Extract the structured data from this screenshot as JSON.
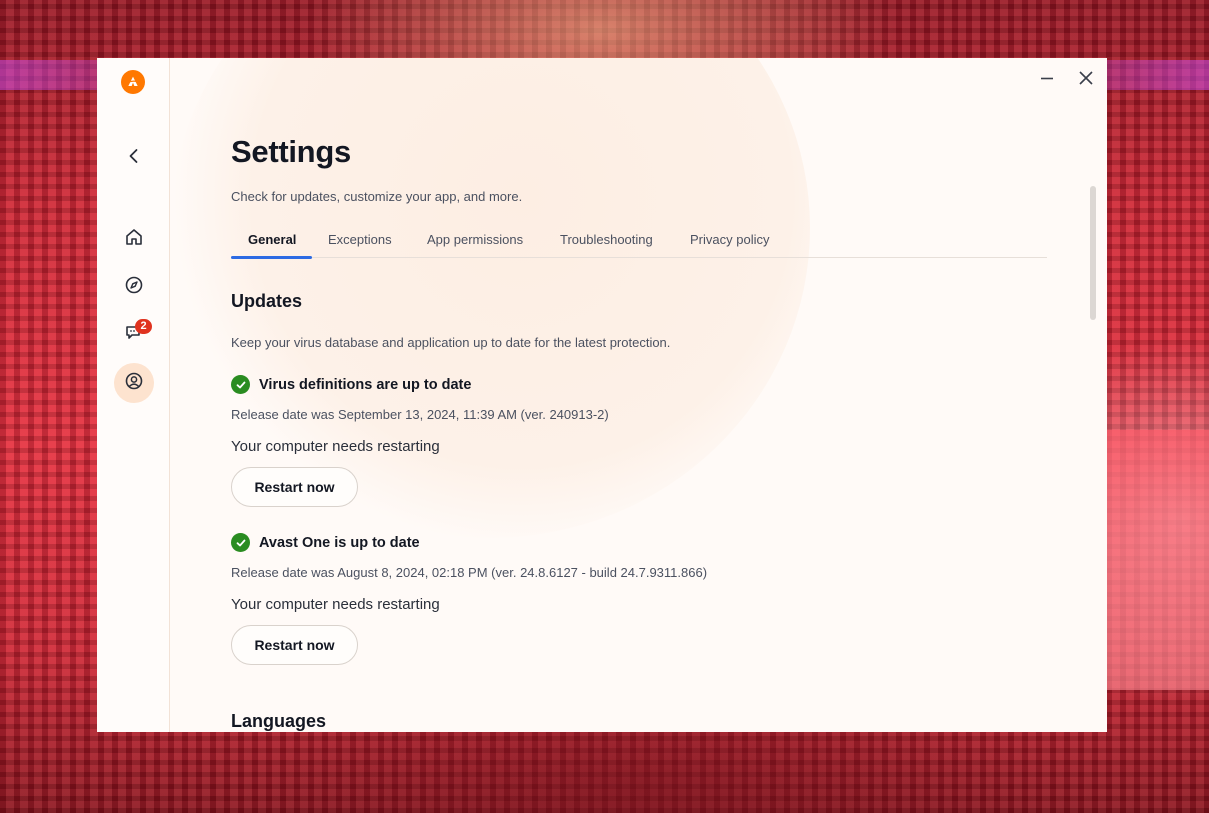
{
  "sidebar": {
    "logo_icon": "avast-logo-icon",
    "back_icon": "chevron-left-icon",
    "items": [
      {
        "icon": "home-icon"
      },
      {
        "icon": "compass-icon"
      },
      {
        "icon": "messages-icon",
        "badge": "2"
      },
      {
        "icon": "account-icon",
        "active": true
      }
    ]
  },
  "window": {
    "minimize_icon": "minimize-icon",
    "close_icon": "close-icon"
  },
  "header": {
    "title": "Settings",
    "subtitle": "Check for updates, customize your app, and more."
  },
  "tabs": [
    {
      "label": "General",
      "active": true
    },
    {
      "label": "Exceptions"
    },
    {
      "label": "App permissions"
    },
    {
      "label": "Troubleshooting"
    },
    {
      "label": "Privacy policy"
    }
  ],
  "updates": {
    "heading": "Updates",
    "description": "Keep your virus database and application up to date for the latest protection.",
    "items": [
      {
        "status": "Virus definitions are up to date",
        "release": "Release date was September 13, 2024, 11:39 AM (ver. 240913-2)",
        "needs": "Your computer needs restarting",
        "button": "Restart now"
      },
      {
        "status": "Avast One is up to date",
        "release": "Release date was August 8, 2024, 02:18 PM (ver. 24.8.6127 - build 24.7.9311.866)",
        "needs": "Your computer needs restarting",
        "button": "Restart now"
      }
    ]
  },
  "languages": {
    "heading": "Languages"
  },
  "colors": {
    "accent": "#ff7800",
    "tab_underline": "#2d6be3",
    "success": "#2a8c21",
    "badge": "#e0331f"
  }
}
